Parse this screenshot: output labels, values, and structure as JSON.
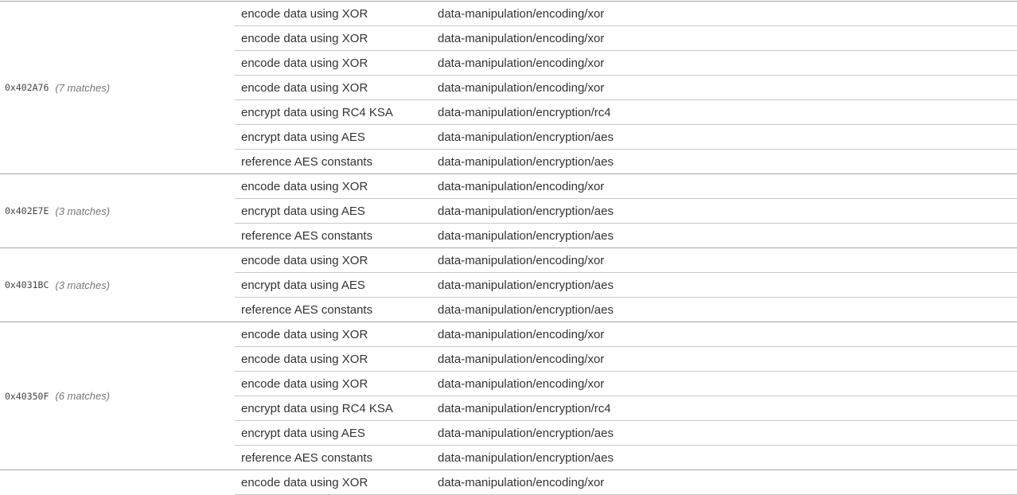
{
  "groups": [
    {
      "address": "0x402A76",
      "count_label": "(7 matches)",
      "matches": [
        {
          "rule": "encode data using XOR",
          "namespace": "data-manipulation/encoding/xor"
        },
        {
          "rule": "encode data using XOR",
          "namespace": "data-manipulation/encoding/xor"
        },
        {
          "rule": "encode data using XOR",
          "namespace": "data-manipulation/encoding/xor"
        },
        {
          "rule": "encode data using XOR",
          "namespace": "data-manipulation/encoding/xor"
        },
        {
          "rule": "encrypt data using RC4 KSA",
          "namespace": "data-manipulation/encryption/rc4"
        },
        {
          "rule": "encrypt data using AES",
          "namespace": "data-manipulation/encryption/aes"
        },
        {
          "rule": "reference AES constants",
          "namespace": "data-manipulation/encryption/aes"
        }
      ]
    },
    {
      "address": "0x402E7E",
      "count_label": "(3 matches)",
      "matches": [
        {
          "rule": "encode data using XOR",
          "namespace": "data-manipulation/encoding/xor"
        },
        {
          "rule": "encrypt data using AES",
          "namespace": "data-manipulation/encryption/aes"
        },
        {
          "rule": "reference AES constants",
          "namespace": "data-manipulation/encryption/aes"
        }
      ]
    },
    {
      "address": "0x4031BC",
      "count_label": "(3 matches)",
      "matches": [
        {
          "rule": "encode data using XOR",
          "namespace": "data-manipulation/encoding/xor"
        },
        {
          "rule": "encrypt data using AES",
          "namespace": "data-manipulation/encryption/aes"
        },
        {
          "rule": "reference AES constants",
          "namespace": "data-manipulation/encryption/aes"
        }
      ]
    },
    {
      "address": "0x40350F",
      "count_label": "(6 matches)",
      "matches": [
        {
          "rule": "encode data using XOR",
          "namespace": "data-manipulation/encoding/xor"
        },
        {
          "rule": "encode data using XOR",
          "namespace": "data-manipulation/encoding/xor"
        },
        {
          "rule": "encode data using XOR",
          "namespace": "data-manipulation/encoding/xor"
        },
        {
          "rule": "encrypt data using RC4 KSA",
          "namespace": "data-manipulation/encryption/rc4"
        },
        {
          "rule": "encrypt data using AES",
          "namespace": "data-manipulation/encryption/aes"
        },
        {
          "rule": "reference AES constants",
          "namespace": "data-manipulation/encryption/aes"
        }
      ]
    },
    {
      "address": "",
      "count_label": "",
      "matches": [
        {
          "rule": "encode data using XOR",
          "namespace": "data-manipulation/encoding/xor"
        }
      ]
    }
  ]
}
